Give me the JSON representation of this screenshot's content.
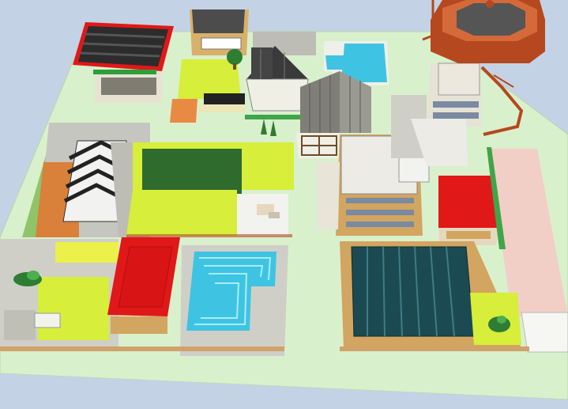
{
  "scene": {
    "view": "isometric-city-block",
    "colors": {
      "sky": "#c4d2e6",
      "ground": "#d9f0cc",
      "grass_lime": "#d7ee3a",
      "grass_dark": "#2f6b2c",
      "pavement": "#cfcfc8",
      "red_roof": "#e01818",
      "pool_water": "#3ec4e2",
      "solar_panel": "#1c4a52",
      "tan_wall": "#d2a560",
      "brown_tower": "#b5481e"
    }
  }
}
